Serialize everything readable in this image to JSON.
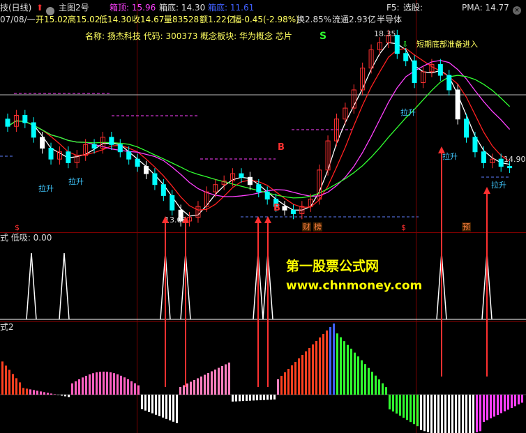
{
  "header": {
    "stock_name_suffix": "技(日线)",
    "chart_template": "主图2号",
    "box_top_label": "箱顶: 15.96",
    "box_bottom_label": "箱底: 14.30",
    "box_bottom_label2": "箱底: 11.61",
    "f5_label": "F5:",
    "select_label": "选股:",
    "pma_label": "PMA: 14.77",
    "info_line": {
      "date": "07/08/一",
      "open": "开15.02",
      "high": "高15.02",
      "low": "低14.30",
      "close": "收14.67",
      "volume": "量83528",
      "amount": "额1.22亿",
      "change": "幅-0.45(-2.98%)",
      "turnover": "换2.85%",
      "float": "流通2.93亿",
      "sector": "半导体"
    },
    "stock_info": "名称: 扬杰科技  代码: 300373  概念板块: 华为概念 芯片"
  },
  "annotations": {
    "price_high": "18.35",
    "price_low": "13.08",
    "price_last": "14.90",
    "short_term_bottom": "短期底部准备进入",
    "lift_labels": [
      "拉升",
      "拉升",
      "拉升",
      "拉升",
      "拉升"
    ],
    "s_marker": "S",
    "b_markers": [
      "B",
      "B"
    ],
    "bottom_tags": [
      "$",
      "财",
      "榜",
      "$",
      "预"
    ]
  },
  "indicator1": {
    "title": "式 低吸: 0.00",
    "watermark_cn": "第一股票公式网",
    "watermark_url": "www.chnmoney.com"
  },
  "indicator2": {
    "title": "式2"
  },
  "colors": {
    "up": "#ff3030",
    "down": "#00ffff",
    "ma1": "#ffffff",
    "ma2": "#ff2020",
    "ma3": "#ff40ff",
    "ma4": "#30ff30",
    "yellow": "#ffff00",
    "accent_arrow": "#ff3030"
  },
  "chart_data": {
    "type": "candlestick",
    "y_range": [
      11.61,
      18.35
    ],
    "price_ticks_visible": [
      "18.35",
      "13.08",
      "14.90"
    ],
    "close_series": [
      15.8,
      16.1,
      15.9,
      15.5,
      15.2,
      14.9,
      15.1,
      14.8,
      15.0,
      15.3,
      15.2,
      15.5,
      15.3,
      15.1,
      14.9,
      14.7,
      14.5,
      14.2,
      13.9,
      13.5,
      13.2,
      13.3,
      13.6,
      14.0,
      14.2,
      14.3,
      14.5,
      14.4,
      14.2,
      14.0,
      13.8,
      13.6,
      13.5,
      13.4,
      13.6,
      13.8,
      14.6,
      15.4,
      16.0,
      16.3,
      16.8,
      17.4,
      17.9,
      18.1,
      18.3,
      17.8,
      17.6,
      17.0,
      17.3,
      17.5,
      17.2,
      16.8,
      16.0,
      15.5,
      15.1,
      14.8,
      14.9,
      14.7,
      14.67
    ],
    "signal_spikes_x": [
      45,
      92,
      237,
      266,
      370,
      384,
      633,
      698
    ],
    "histogram_note": "momentum bars: red/pink above axis then green/cyan/white below"
  }
}
